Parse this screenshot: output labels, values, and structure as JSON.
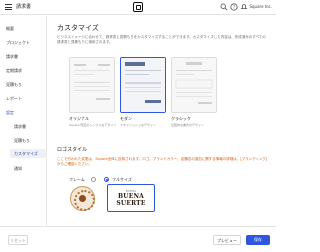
{
  "header": {
    "title": "請求書",
    "user": "Square Inc."
  },
  "sidebar": {
    "items": [
      {
        "label": "概要"
      },
      {
        "label": "プロジェクト"
      },
      {
        "label": "請求書"
      },
      {
        "label": "定期請求"
      },
      {
        "label": "見積もり"
      },
      {
        "label": "レポート"
      },
      {
        "label": "設定"
      },
      {
        "label": "請求書"
      },
      {
        "label": "見積もり"
      },
      {
        "label": "カスタマイズ"
      },
      {
        "label": "通知"
      }
    ]
  },
  "main": {
    "title": "カスタマイズ",
    "description": "ビジネスイメージに合わせて、請求書と見積もりをカスタマイズすることができます。カスタマイズした内容は、作成済みのすべての請求書と見積もりに適用されます。",
    "themes": [
      {
        "name": "オリジナル",
        "desc": "Square 既定のシンプルなデザイン"
      },
      {
        "name": "モダン",
        "desc": "スタイリッシュなデザイン"
      },
      {
        "name": "クラシック",
        "desc": "伝統的な書式のデザイン"
      }
    ],
    "logo_section": {
      "title": "ロゴスタイル",
      "description": "ここで行われた変更は、Square全体に反映されます。ロゴ、ブランドカラー、店舗名の追加に関する情報の詳細は、[ブランディング] からご確認ください。",
      "options": [
        {
          "label": "フレーム"
        },
        {
          "label": "フルサイズ"
        }
      ],
      "full_logo_small": "BUENA",
      "full_logo_main_1": "BUENA",
      "full_logo_main_2": "SUERTE"
    }
  },
  "footer": {
    "reset": "リセット",
    "preview": "プレビュー",
    "save": "保存"
  },
  "colors": {
    "accent": "#2f56e0",
    "active_bg": "#eef0f8"
  }
}
